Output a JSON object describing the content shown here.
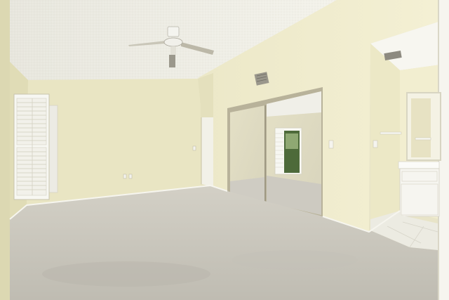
{
  "scene": {
    "room": "empty bedroom",
    "features": [
      "ceiling-fan",
      "plantation-shutter-window",
      "mirrored-closet-doors",
      "open-doorway",
      "bathroom-vanity",
      "ceiling-vent",
      "carpet-floor",
      "tile-floor"
    ]
  },
  "colors": {
    "ceiling": "#efeee6",
    "wall_left": "#e6e2bd",
    "wall_back": "#ebe7c6",
    "wall_right": "#f1edcf",
    "carpet": "#c9c6bd",
    "shutter": "#f7f7f2",
    "mirror_frame": "#b9b39a",
    "tile": "#ecebe2",
    "vanity": "#f4f3ee"
  }
}
